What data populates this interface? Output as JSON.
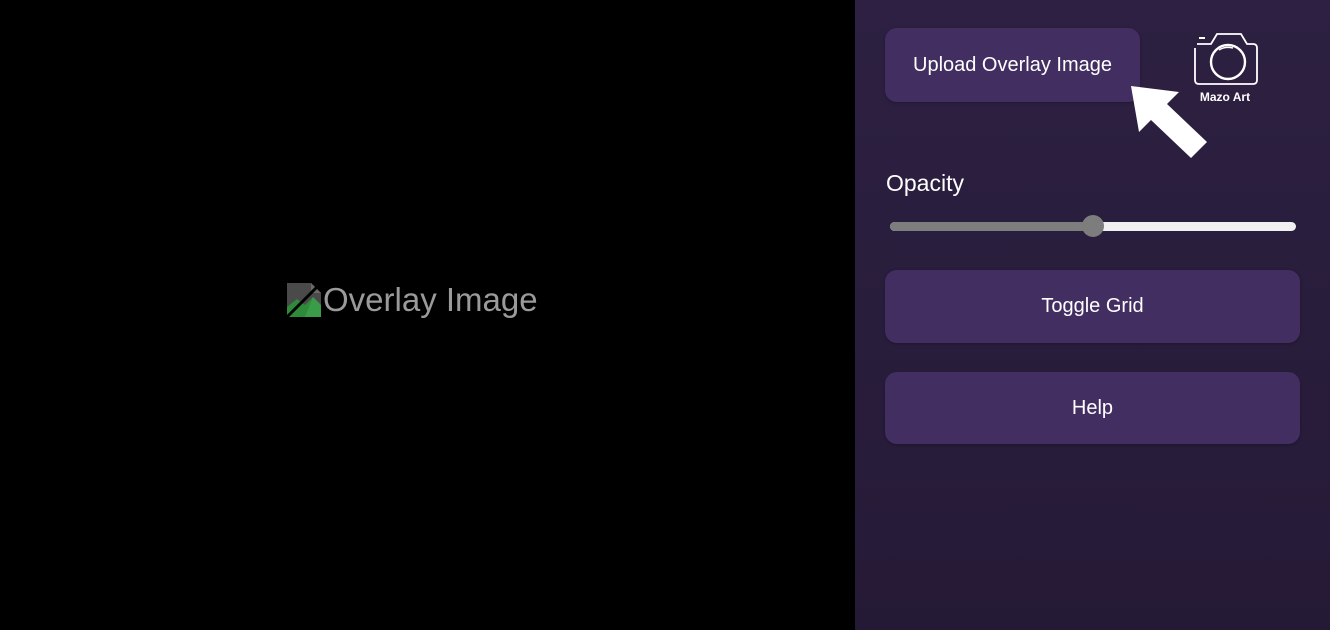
{
  "viewer": {
    "overlay_alt": "Overlay Image"
  },
  "panel": {
    "upload_label": "Upload Overlay Image",
    "logo_text": "Mazo Art",
    "opacity_label": "Opacity",
    "opacity_value": 0.5,
    "toggle_grid_label": "Toggle Grid",
    "help_label": "Help"
  },
  "icons": {
    "broken_image": "broken-image-icon",
    "logo": "camera-icon",
    "pointer": "arrow-pointer-icon"
  },
  "colors": {
    "panel_bg": "#2d2042",
    "button_bg": "#432e62",
    "button_text": "#ffffff",
    "alt_text": "#9a9a9a",
    "slider_filled": "#7d7d7d",
    "slider_empty": "#f1f1f1"
  }
}
